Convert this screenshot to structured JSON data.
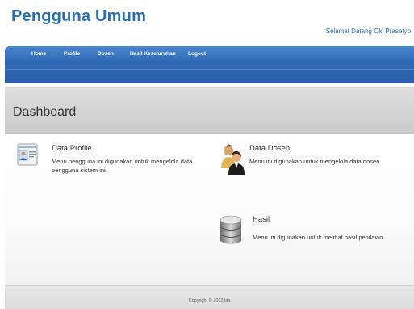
{
  "header": {
    "site_title": "Pengguna Umum",
    "welcome": "Selamat Datang Oki Prasetyo"
  },
  "nav": {
    "items": [
      {
        "label": "Home"
      },
      {
        "label": "Profile"
      },
      {
        "label": "Dosen"
      },
      {
        "label": "Hasil Keseluruhan"
      },
      {
        "label": "Logout"
      }
    ]
  },
  "page": {
    "title": "Dashboard"
  },
  "cards": [
    {
      "title": "Data Profile",
      "description": "Menu pengguna ini digunakan untuk mengelola data pengguna sistem ini.",
      "icon": "profile-card-icon"
    },
    {
      "title": "Data Dosen",
      "description": "Menu ini digunakan untuk mengelola data dosen.",
      "icon": "users-icon"
    },
    {
      "title": "Hasil",
      "description": "Menu ini digunakan untuk melihat hasil penilaian.",
      "icon": "database-icon"
    }
  ],
  "footer": {
    "copyright": "Copyright © 2012 bla"
  },
  "colors": {
    "accent": "#2a6fb0",
    "navbar": "#2e67b3"
  }
}
